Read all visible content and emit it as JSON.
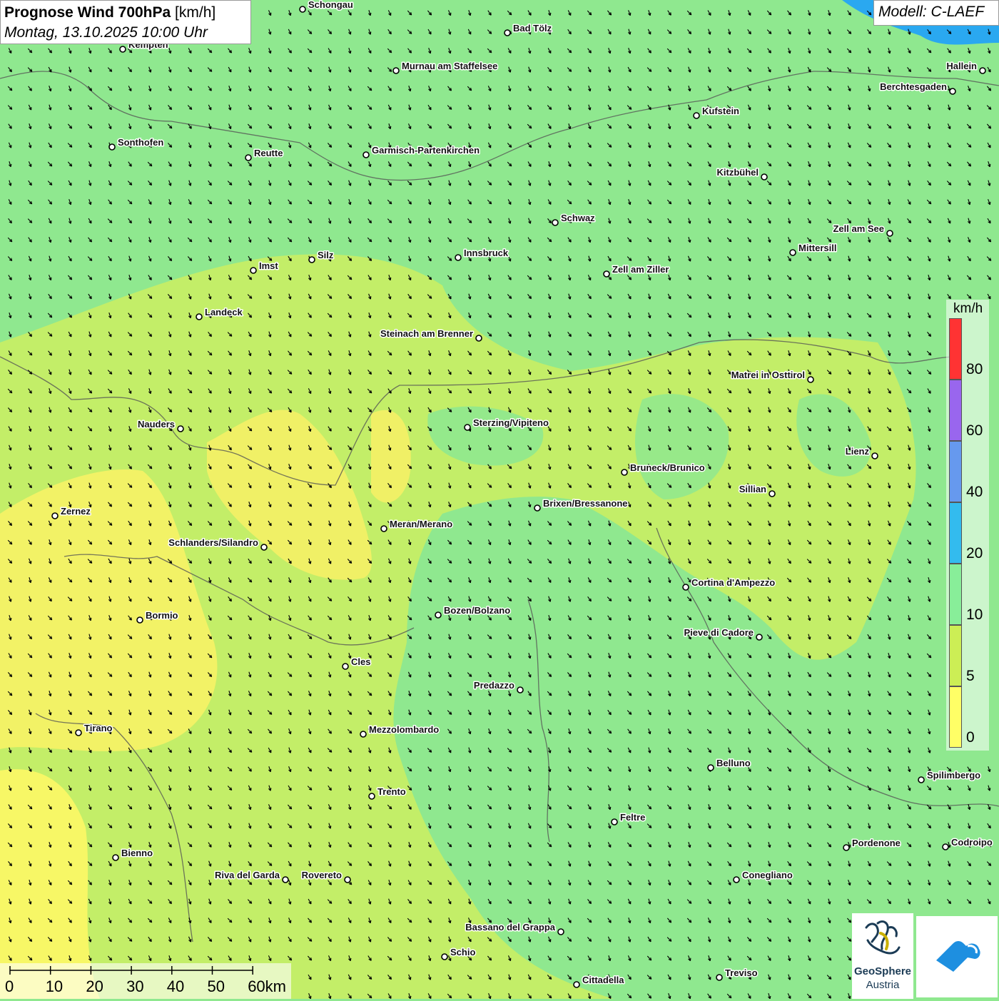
{
  "title": {
    "main": "Prognose Wind 700hPa",
    "unit": "[km/h]",
    "date": "Montag, 13.10.2025 10:00 Uhr"
  },
  "model": "Modell: C-LAEF",
  "legend": {
    "unit": "km/h",
    "labels": [
      "80",
      "60",
      "40",
      "20",
      "10",
      "5",
      "0"
    ],
    "colors": [
      "#ff3333",
      "#9966ee",
      "#6699ee",
      "#33bbee",
      "#88ee99",
      "#ccee55",
      "#ffff66"
    ]
  },
  "wind": {
    "direction_deg": 150,
    "north_region": "10-20",
    "south_region": "0-10"
  },
  "scalebar": {
    "labels": [
      "0",
      "10",
      "20",
      "30",
      "40",
      "50",
      "60km"
    ]
  },
  "logos": {
    "geosphere_name": "GeoSphere",
    "geosphere_sub": "Austria"
  },
  "cities": [
    "Schongau",
    "Bad Tölz",
    "Kempten",
    "Murnau am Staffelsee",
    "Hallein",
    "Berchtesgaden",
    "Kufstein",
    "Sonthofen",
    "Reutte",
    "Garmisch-Partenkirchen",
    "Kitzbühel",
    "Schwaz",
    "Zell am See",
    "Mittersill",
    "Imst",
    "Silz",
    "Innsbruck",
    "Zell am Ziller",
    "Landeck",
    "Steinach am Brenner",
    "Matrei in Osttirol",
    "Nauders",
    "Sterzing/Vipiteno",
    "Lienz",
    "Bruneck/Brunico",
    "Sillian",
    "Zernez",
    "Brixen/Bressanone",
    "Meran/Merano",
    "Schlanders/Silandro",
    "Cortina d'Ampezzo",
    "Bormio",
    "Bozen/Bolzano",
    "Pieve di Cadore",
    "Cles",
    "Predazzo",
    "Tirano",
    "Mezzolombardo",
    "Belluno",
    "Spilimbergo",
    "Trento",
    "Feltre",
    "Pordenone",
    "Codroipo",
    "Bienno",
    "Riva del Garda",
    "Rovereto",
    "Conegliano",
    "Bassano del Grappa",
    "Schio",
    "Treviso",
    "Cittadella"
  ]
}
